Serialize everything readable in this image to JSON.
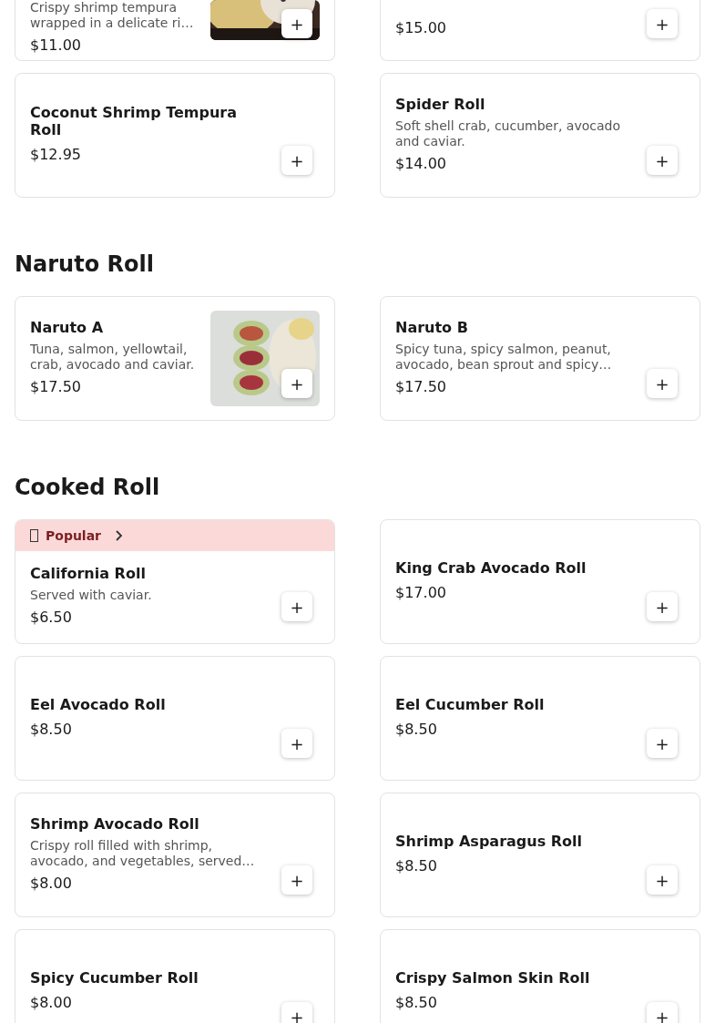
{
  "sections": [
    {
      "items": [
        {
          "cut": true,
          "description": "Crispy shrimp tempura wrapped in a delicate ri…",
          "price": "$11.00"
        },
        {
          "cut": true,
          "price": "$15.00"
        },
        {
          "name": "Coconut Shrimp Tempura Roll",
          "price": "$12.95"
        },
        {
          "name": "Spider Roll",
          "description": "Soft shell crab, cucumber, avocado and caviar.",
          "price": "$14.00"
        }
      ]
    },
    {
      "title": "Naruto Roll",
      "items": [
        {
          "name": "Naruto A",
          "description": "Tuna, salmon, yellowtail, crab, avocado and caviar.",
          "price": "$17.50"
        },
        {
          "name": "Naruto B",
          "description": "Spicy tuna, spicy salmon, peanut, avocado, bean sprout and spicy…",
          "price": "$17.50"
        }
      ]
    },
    {
      "title": "Cooked Roll",
      "items": [
        {
          "badge": {
            "label": "Popular"
          },
          "name": "California Roll",
          "description": "Served with caviar.",
          "price": "$6.50"
        },
        {
          "name": "King Crab Avocado Roll",
          "price": "$17.00"
        },
        {
          "name": "Eel Avocado Roll",
          "price": "$8.50"
        },
        {
          "name": "Eel Cucumber Roll",
          "price": "$8.50"
        },
        {
          "name": "Shrimp Avocado Roll",
          "description": "Crispy roll filled with shrimp, avocado, and vegetables, served…",
          "price": "$8.00"
        },
        {
          "name": "Shrimp Asparagus Roll",
          "price": "$8.50"
        },
        {
          "name": "Spicy Cucumber Roll",
          "price": "$8.00"
        },
        {
          "name": "Crispy Salmon Skin Roll",
          "price": "$8.50"
        }
      ]
    }
  ],
  "add_label": "+"
}
